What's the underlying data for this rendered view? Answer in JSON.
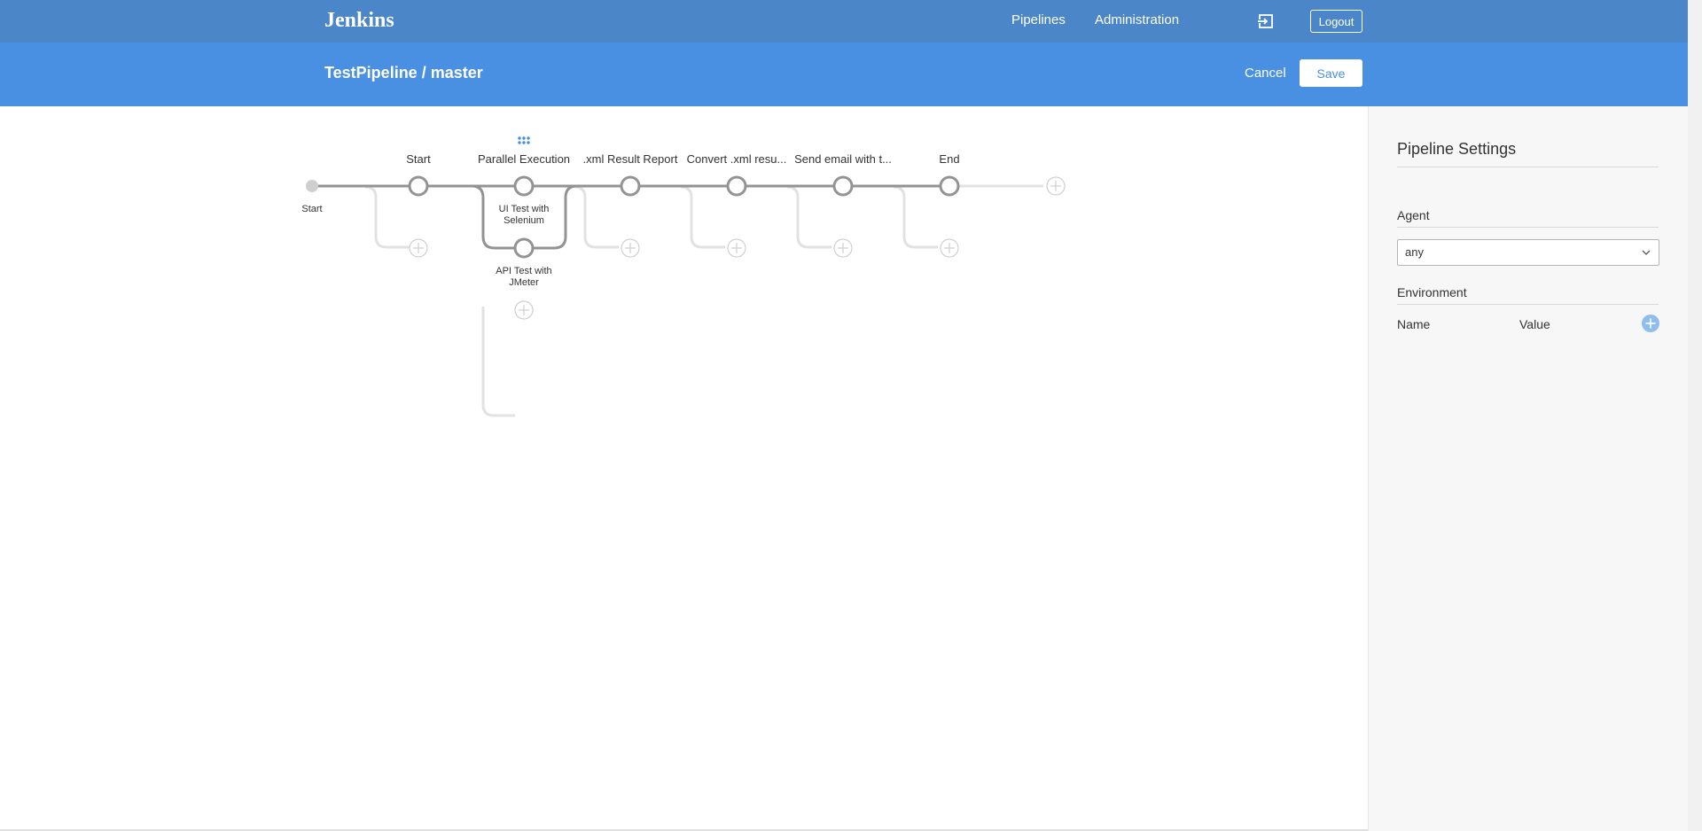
{
  "header": {
    "logo": "Jenkins",
    "nav": [
      "Pipelines",
      "Administration"
    ],
    "logout_label": "Logout",
    "exit_icon": "exit-icon"
  },
  "subheader": {
    "title": "TestPipeline / master",
    "cancel_label": "Cancel",
    "save_label": "Save"
  },
  "graph": {
    "start_label": "Start",
    "stages": [
      {
        "label": "Start"
      },
      {
        "label": "Parallel Execution",
        "branches": [
          "UI Test with Selenium",
          "API Test with JMeter"
        ]
      },
      {
        "label": ".xml Result Report"
      },
      {
        "label": "Convert .xml resu..."
      },
      {
        "label": "Send email with t..."
      },
      {
        "label": "End"
      }
    ],
    "branch_lines": [
      [
        "UI Test with",
        "Selenium"
      ],
      [
        "API Test with",
        "JMeter"
      ]
    ],
    "drag_handle_icon": "grip-icon",
    "add_icon": "plus-circle-icon"
  },
  "settings": {
    "title": "Pipeline Settings",
    "agent_label": "Agent",
    "agent_value": "any",
    "environment_label": "Environment",
    "env_columns": [
      "Name",
      "Value"
    ],
    "colors": {
      "accent": "#4a90e2",
      "header": "#4a86c8",
      "node": "#949393"
    }
  }
}
